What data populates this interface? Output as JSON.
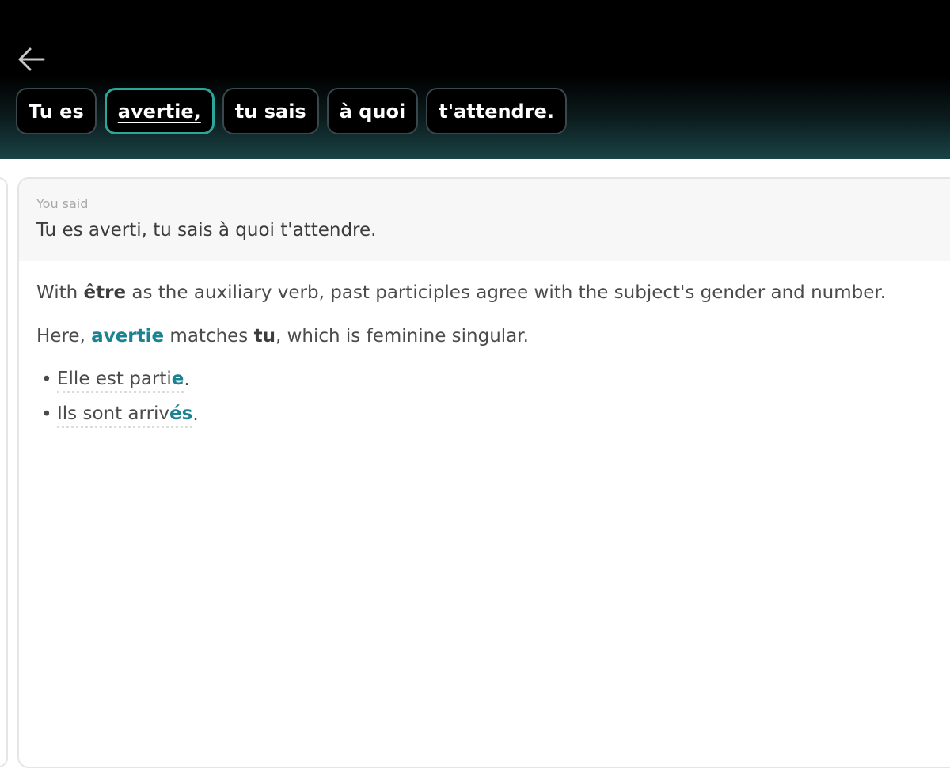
{
  "header": {
    "back_icon": "arrow-left-icon",
    "chips": [
      {
        "label": "Tu es",
        "selected": false
      },
      {
        "label": "avertie,",
        "selected": true
      },
      {
        "label": "tu sais",
        "selected": false
      },
      {
        "label": "à quoi",
        "selected": false
      },
      {
        "label": "t'attendre.",
        "selected": false
      }
    ]
  },
  "you_said": {
    "label": "You said",
    "text": "Tu es averti, tu sais à quoi t'attendre."
  },
  "explanation": {
    "p1": {
      "before": "With ",
      "bold": "être",
      "after": " as the auxiliary verb, past participles agree with the subject's gender and number."
    },
    "p2": {
      "before": "Here, ",
      "accent": "avertie",
      "middle": " matches ",
      "bold": "tu",
      "after": ", which is feminine singular."
    },
    "examples": [
      {
        "stem": "Elle est parti",
        "ending": "e",
        "punct": "."
      },
      {
        "stem": "Ils sont arriv",
        "ending": "és",
        "punct": "."
      }
    ]
  },
  "colors": {
    "accent": "#1a8290",
    "selected_chip_border": "#2ba69b",
    "header_bg": "#000000"
  }
}
